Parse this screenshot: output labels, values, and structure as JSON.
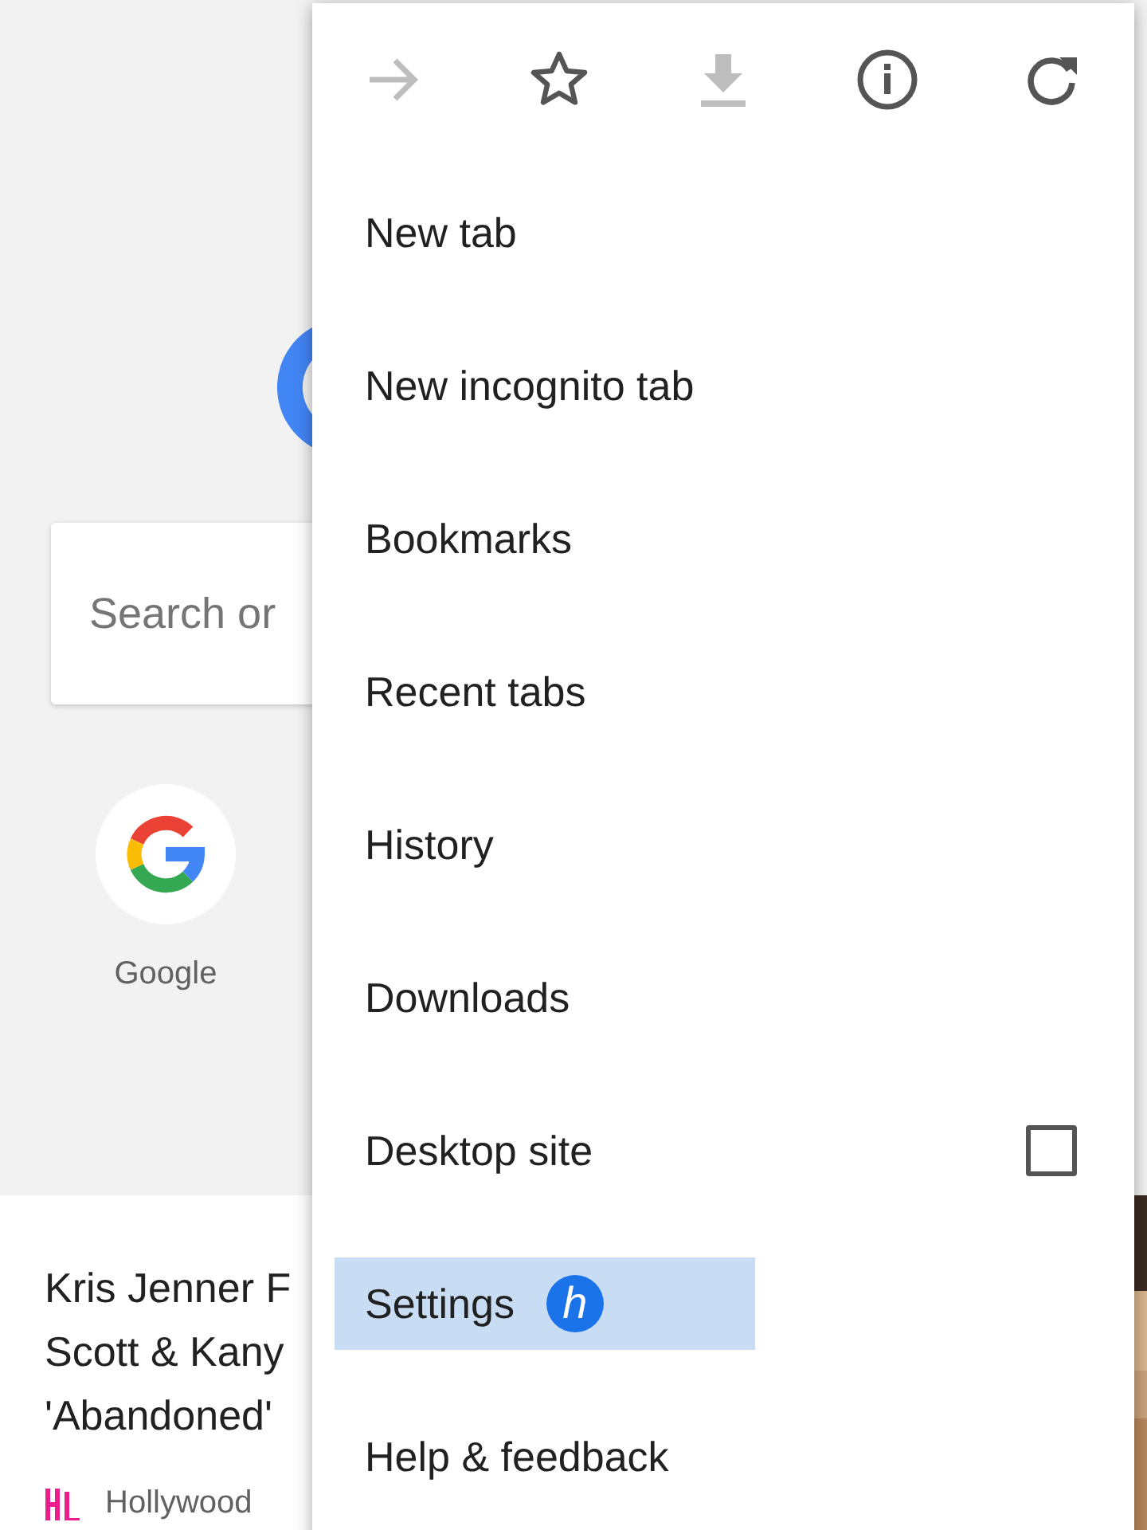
{
  "page": {
    "search": {
      "placeholder": "Search or"
    },
    "shortcuts": [
      {
        "label": "Google"
      }
    ],
    "article": {
      "headline_lines": [
        "Kris Jenner F",
        "Scott & Kany",
        "'Abandoned'"
      ],
      "source": "Hollywood"
    }
  },
  "menu": {
    "icons": [
      {
        "kind": "forward",
        "disabled": true
      },
      {
        "kind": "star",
        "disabled": false
      },
      {
        "kind": "download",
        "disabled": true
      },
      {
        "kind": "info",
        "disabled": false
      },
      {
        "kind": "refresh",
        "disabled": false
      }
    ],
    "items": [
      {
        "label": "New tab",
        "kind": "plain",
        "selected": false
      },
      {
        "label": "New incognito tab",
        "kind": "plain",
        "selected": false
      },
      {
        "label": "Bookmarks",
        "kind": "plain",
        "selected": false
      },
      {
        "label": "Recent tabs",
        "kind": "plain",
        "selected": false
      },
      {
        "label": "History",
        "kind": "plain",
        "selected": false
      },
      {
        "label": "Downloads",
        "kind": "plain",
        "selected": false
      },
      {
        "label": "Desktop site",
        "kind": "checkbox",
        "checked": false,
        "selected": false
      },
      {
        "label": "Settings",
        "kind": "plain",
        "selected": true,
        "badge": "h"
      },
      {
        "label": "Help & feedback",
        "kind": "plain",
        "selected": false
      }
    ]
  }
}
